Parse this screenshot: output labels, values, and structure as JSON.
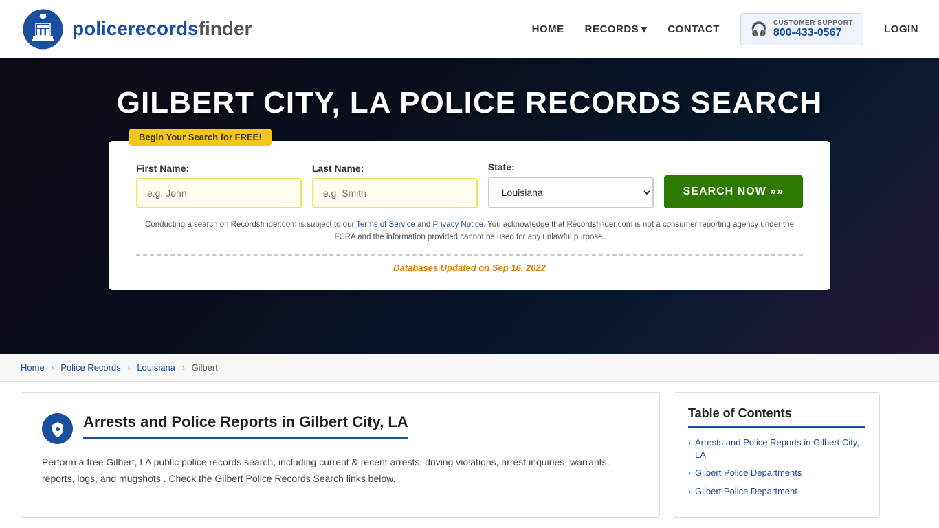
{
  "header": {
    "logo_text_light": "policerecords",
    "logo_text_bold": "finder",
    "nav": {
      "home": "HOME",
      "records": "RECORDS",
      "contact": "CONTACT",
      "login": "LOGIN"
    },
    "support": {
      "label": "CUSTOMER SUPPORT",
      "phone": "800-433-0567"
    }
  },
  "hero": {
    "title": "GILBERT CITY, LA POLICE RECORDS SEARCH",
    "badge": "Begin Your Search for FREE!",
    "form": {
      "first_name_label": "First Name:",
      "first_name_placeholder": "e.g. John",
      "last_name_label": "Last Name:",
      "last_name_placeholder": "e.g. Smith",
      "state_label": "State:",
      "state_value": "Louisiana",
      "search_btn": "SEARCH NOW »»"
    },
    "disclaimer": "Conducting a search on Recordsfinder.com is subject to our Terms of Service and Privacy Notice. You acknowledge that Recordsfinder.com is not a consumer reporting agency under the FCRA and the information provided cannot be used for any unlawful purpose.",
    "db_updated_label": "Databases Updated on",
    "db_updated_date": "Sep 16, 2022"
  },
  "breadcrumb": {
    "home": "Home",
    "police_records": "Police Records",
    "louisiana": "Louisiana",
    "current": "Gilbert"
  },
  "article": {
    "title": "Arrests and Police Reports in Gilbert City, LA",
    "body": "Perform a free Gilbert, LA public police records search, including current & recent arrests, driving violations, arrest inquiries, warrants, reports, logs, and mugshots . Check the Gilbert Police Records Search links below."
  },
  "toc": {
    "title": "Table of Contents",
    "items": [
      "Arrests and Police Reports in Gilbert City, LA",
      "Gilbert Police Departments",
      "Gilbert Police Department"
    ]
  }
}
